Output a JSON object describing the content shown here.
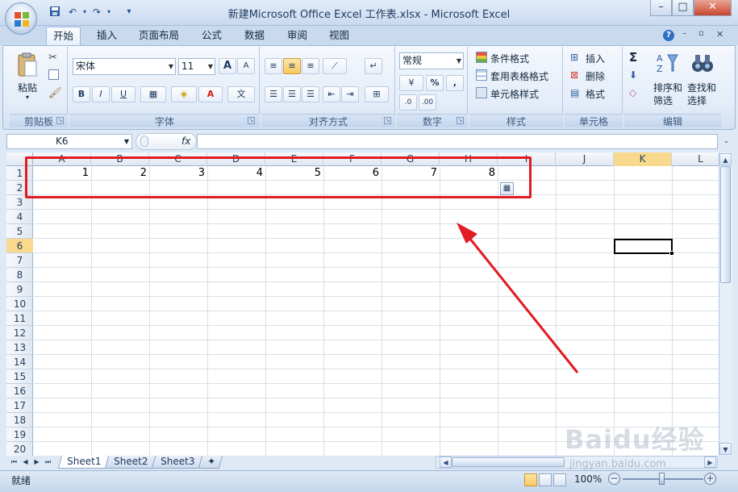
{
  "window": {
    "title": "新建Microsoft Office Excel 工作表.xlsx - Microsoft Excel",
    "controls": [
      "–",
      "□",
      "✕"
    ]
  },
  "quick_access": {
    "save_icon": "save-icon",
    "undo_icon": "undo-icon",
    "redo_icon": "redo-icon",
    "customize_icon": "customize-icon"
  },
  "ribbon_tabs": [
    "开始",
    "插入",
    "页面布局",
    "公式",
    "数据",
    "审阅",
    "视图"
  ],
  "active_tab": "开始",
  "ribbon": {
    "clipboard": {
      "label": "剪贴板",
      "paste": "粘贴"
    },
    "font": {
      "label": "字体",
      "font_name": "宋体",
      "font_size": "11",
      "bold": "B",
      "italic": "I",
      "underline": "U",
      "grow": "A",
      "shrink": "A",
      "wen": "文"
    },
    "alignment": {
      "label": "对齐方式"
    },
    "number": {
      "label": "数字",
      "format": "常规",
      "percent": "%",
      "comma": ","
    },
    "styles": {
      "label": "样式",
      "conditional": "条件格式",
      "table": "套用表格格式",
      "cell_styles": "单元格样式"
    },
    "cells": {
      "label": "单元格",
      "insert": "插入",
      "delete": "删除",
      "format": "格式"
    },
    "editing": {
      "label": "编辑",
      "sum": "Σ",
      "sort": "排序和",
      "sort2": "筛选",
      "find": "查找和",
      "find2": "选择"
    }
  },
  "formula_bar": {
    "name_box": "K6",
    "fx": "fx",
    "formula": ""
  },
  "columns": [
    "A",
    "B",
    "C",
    "D",
    "E",
    "F",
    "G",
    "H",
    "I",
    "J",
    "K",
    "L"
  ],
  "active_column": "K",
  "rows": [
    "1",
    "2",
    "3",
    "4",
    "5",
    "6",
    "7",
    "8",
    "9",
    "10",
    "11",
    "12",
    "13",
    "14",
    "15",
    "16",
    "17",
    "18",
    "19",
    "20"
  ],
  "active_row": "6",
  "cells": {
    "A1": "1",
    "B1": "2",
    "C1": "3",
    "D1": "4",
    "E1": "5",
    "F1": "6",
    "G1": "7",
    "H1": "8"
  },
  "sheets": [
    "Sheet1",
    "Sheet2",
    "Sheet3"
  ],
  "active_sheet": "Sheet1",
  "status": {
    "mode": "就绪",
    "zoom": "100%",
    "minus": "−",
    "plus": "+"
  },
  "watermark": {
    "text": "Baidu经验",
    "url": "jingyan.baidu.com"
  },
  "colors": {
    "highlight": "#e11b22",
    "active_header": "#f9d98e",
    "ribbon_bg": "#e3ecf8"
  }
}
